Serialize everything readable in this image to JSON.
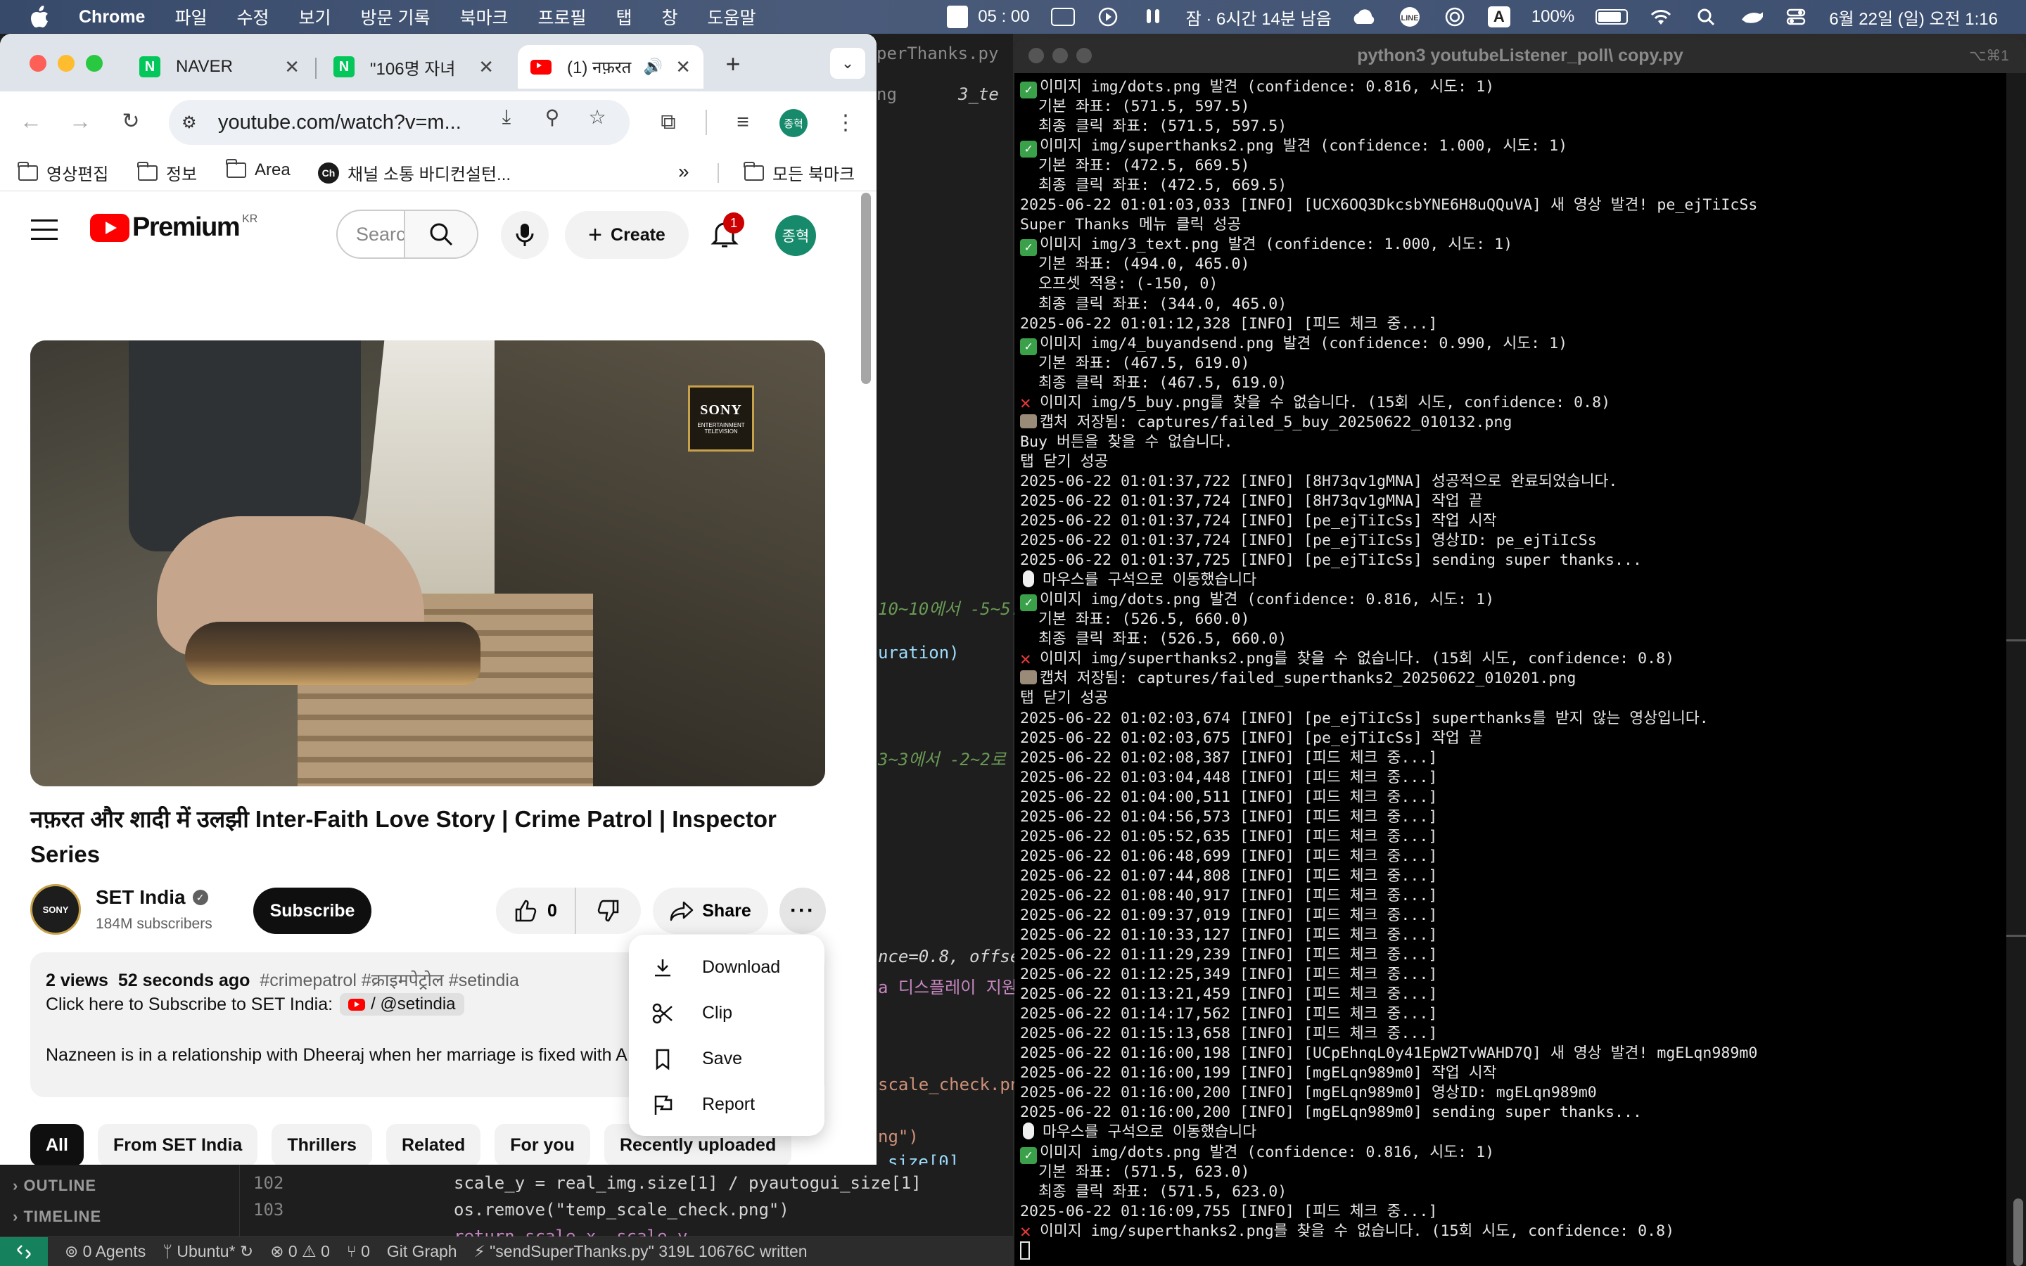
{
  "menubar": {
    "app": "Chrome",
    "menus": [
      "파일",
      "수정",
      "보기",
      "방문 기록",
      "북마크",
      "프로필",
      "탭",
      "창",
      "도움말"
    ],
    "timer": "05 : 00",
    "sleep_status": "잠 · 6시간 14분 남음",
    "input_source": "A",
    "battery": "100%",
    "datetime": "6월 22일 (일) 오전 1:16"
  },
  "chrome": {
    "tabs": [
      {
        "title": "NAVER",
        "favicon": "N",
        "color": "#03c75a"
      },
      {
        "title": "\"106명 자녀",
        "favicon": "N",
        "color": "#03c75a"
      },
      {
        "title": "(1) नफ़रत",
        "favicon": "yt",
        "color": "#ff0000"
      }
    ],
    "url": "youtube.com/watch?v=m...",
    "profile_initial": "종혁",
    "bookmarks": [
      "영상편집",
      "정보",
      "Area",
      "채널 소통 바디컨설턴...",
      "모든 북마크"
    ],
    "bookmark_ch_icon": "Ch"
  },
  "youtube": {
    "logo": "Premium",
    "region": "KR",
    "search_placeholder": "Search",
    "create_label": "Create",
    "notif_count": "1",
    "avatar": "종혁",
    "video_title": "नफ़रत और शादी में उलझी Inter-Faith Love Story | Crime Patrol | Inspector Series",
    "sony_badge_top": "SONY",
    "sony_badge_bottom": "ENTERTAINMENT TELEVISION",
    "channel": {
      "name": "SET India",
      "subscribers": "184M subscribers",
      "avatar_text": "SONY"
    },
    "subscribe_label": "Subscribe",
    "likes": "0",
    "share_label": "Share",
    "description": {
      "views": "2 views",
      "age": "52 seconds ago",
      "tags": "#crimepatrol #क्राइमपेट्रोल #setindia",
      "subscribe_line": "Click here to Subscribe to SET India:",
      "handle": "/ @setindia",
      "body": "Nazneen is in a relationship with Dheeraj when her marriage is fixed with A"
    },
    "menu": [
      {
        "label": "Download",
        "icon": "download-icon"
      },
      {
        "label": "Clip",
        "icon": "scissors-icon"
      },
      {
        "label": "Save",
        "icon": "bookmark-icon"
      },
      {
        "label": "Report",
        "icon": "flag-icon"
      }
    ],
    "chips": [
      "All",
      "From SET India",
      "Thrillers",
      "Related",
      "For you",
      "Recently uploaded"
    ]
  },
  "editor": {
    "tab_fragment": "3_te",
    "tab_fragment2": "ng",
    "upper_tab_text": "perThanks.py",
    "fragments": {
      "range1": "10~10에서 -5~5.",
      "duration": "uration)",
      "range2": "3~3에서 -2~2로",
      "conf": "nce=0.8, offse",
      "display": "a 디스플레이 지원",
      "scale_png": "scale_check.pn",
      "ng": "ng\")",
      "size0": "size[0]"
    },
    "sidebar_sections": [
      "OUTLINE",
      "TIMELINE"
    ],
    "lines": [
      {
        "no": "102",
        "code": "scale_y = real_img.size[1] / pyautogui_size[1]"
      },
      {
        "no": "103",
        "code": "os.remove(\"temp_scale_check.png\")"
      }
    ],
    "partial_line": "return scale_x, scale_y"
  },
  "statusbar": {
    "agents": "0 Agents",
    "remote": "Ubuntu*",
    "problems": "0 ⚠ 0",
    "ports": "0",
    "git": "Git Graph",
    "message": "\"sendSuperThanks.py\" 319L 10676C written"
  },
  "terminal": {
    "title": "python3 youtubeListener_poll\\ copy.py",
    "shortcut": "⌥⌘1",
    "lines": [
      {
        "icon": "ok",
        "text": "이미지 img/dots.png 발견 (confidence: 0.816, 시도: 1)"
      },
      {
        "icon": "",
        "text": "  기본 좌표: (571.5, 597.5)"
      },
      {
        "icon": "",
        "text": "  최종 클릭 좌표: (571.5, 597.5)"
      },
      {
        "icon": "ok",
        "text": "이미지 img/superthanks2.png 발견 (confidence: 1.000, 시도: 1)"
      },
      {
        "icon": "",
        "text": "  기본 좌표: (472.5, 669.5)"
      },
      {
        "icon": "",
        "text": "  최종 클릭 좌표: (472.5, 669.5)"
      },
      {
        "icon": "",
        "text": "2025-06-22 01:01:03,033 [INFO] [UCX6OQ3DkcsbYNE6H8uQQuVA] 새 영상 발견! pe_ejTiIcSs"
      },
      {
        "icon": "",
        "text": "Super Thanks 메뉴 클릭 성공"
      },
      {
        "icon": "ok",
        "text": "이미지 img/3_text.png 발견 (confidence: 1.000, 시도: 1)"
      },
      {
        "icon": "",
        "text": "  기본 좌표: (494.0, 465.0)"
      },
      {
        "icon": "",
        "text": "  오프셋 적용: (-150, 0)"
      },
      {
        "icon": "",
        "text": "  최종 클릭 좌표: (344.0, 465.0)"
      },
      {
        "icon": "",
        "text": "2025-06-22 01:01:12,328 [INFO] [피드 체크 중...]"
      },
      {
        "icon": "ok",
        "text": "이미지 img/4_buyandsend.png 발견 (confidence: 0.990, 시도: 1)"
      },
      {
        "icon": "",
        "text": "  기본 좌표: (467.5, 619.0)"
      },
      {
        "icon": "",
        "text": "  최종 클릭 좌표: (467.5, 619.0)"
      },
      {
        "icon": "x",
        "text": "이미지 img/5_buy.png를 찾을 수 없습니다. (15회 시도, confidence: 0.8)"
      },
      {
        "icon": "cam",
        "text": "캡처 저장됨: captures/failed_5_buy_20250622_010132.png"
      },
      {
        "icon": "",
        "text": "Buy 버튼을 찾을 수 없습니다."
      },
      {
        "icon": "",
        "text": "탭 닫기 성공"
      },
      {
        "icon": "",
        "text": "2025-06-22 01:01:37,722 [INFO] [8H73qv1gMNA] 성공적으로 완료되었습니다."
      },
      {
        "icon": "",
        "text": "2025-06-22 01:01:37,724 [INFO] [8H73qv1gMNA] 작업 끝"
      },
      {
        "icon": "",
        "text": "2025-06-22 01:01:37,724 [INFO] [pe_ejTiIcSs] 작업 시작"
      },
      {
        "icon": "",
        "text": "2025-06-22 01:01:37,724 [INFO] [pe_ejTiIcSs] 영상ID: pe_ejTiIcSs"
      },
      {
        "icon": "",
        "text": "2025-06-22 01:01:37,725 [INFO] [pe_ejTiIcSs] sending super thanks..."
      },
      {
        "icon": "mouse",
        "text": "마우스를 구석으로 이동했습니다"
      },
      {
        "icon": "ok",
        "text": "이미지 img/dots.png 발견 (confidence: 0.816, 시도: 1)"
      },
      {
        "icon": "",
        "text": "  기본 좌표: (526.5, 660.0)"
      },
      {
        "icon": "",
        "text": "  최종 클릭 좌표: (526.5, 660.0)"
      },
      {
        "icon": "x",
        "text": "이미지 img/superthanks2.png를 찾을 수 없습니다. (15회 시도, confidence: 0.8)"
      },
      {
        "icon": "cam",
        "text": "캡처 저장됨: captures/failed_superthanks2_20250622_010201.png"
      },
      {
        "icon": "",
        "text": "탭 닫기 성공"
      },
      {
        "icon": "",
        "text": "2025-06-22 01:02:03,674 [INFO] [pe_ejTiIcSs] superthanks를 받지 않는 영상입니다."
      },
      {
        "icon": "",
        "text": "2025-06-22 01:02:03,675 [INFO] [pe_ejTiIcSs] 작업 끝"
      },
      {
        "icon": "",
        "text": "2025-06-22 01:02:08,387 [INFO] [피드 체크 중...]"
      },
      {
        "icon": "",
        "text": "2025-06-22 01:03:04,448 [INFO] [피드 체크 중...]"
      },
      {
        "icon": "",
        "text": "2025-06-22 01:04:00,511 [INFO] [피드 체크 중...]"
      },
      {
        "icon": "",
        "text": "2025-06-22 01:04:56,573 [INFO] [피드 체크 중...]"
      },
      {
        "icon": "",
        "text": "2025-06-22 01:05:52,635 [INFO] [피드 체크 중...]"
      },
      {
        "icon": "",
        "text": "2025-06-22 01:06:48,699 [INFO] [피드 체크 중...]"
      },
      {
        "icon": "",
        "text": "2025-06-22 01:07:44,808 [INFO] [피드 체크 중...]"
      },
      {
        "icon": "",
        "text": "2025-06-22 01:08:40,917 [INFO] [피드 체크 중...]"
      },
      {
        "icon": "",
        "text": "2025-06-22 01:09:37,019 [INFO] [피드 체크 중...]"
      },
      {
        "icon": "",
        "text": "2025-06-22 01:10:33,127 [INFO] [피드 체크 중...]"
      },
      {
        "icon": "",
        "text": "2025-06-22 01:11:29,239 [INFO] [피드 체크 중...]"
      },
      {
        "icon": "",
        "text": "2025-06-22 01:12:25,349 [INFO] [피드 체크 중...]"
      },
      {
        "icon": "",
        "text": "2025-06-22 01:13:21,459 [INFO] [피드 체크 중...]"
      },
      {
        "icon": "",
        "text": "2025-06-22 01:14:17,562 [INFO] [피드 체크 중...]"
      },
      {
        "icon": "",
        "text": "2025-06-22 01:15:13,658 [INFO] [피드 체크 중...]"
      },
      {
        "icon": "",
        "text": "2025-06-22 01:16:00,198 [INFO] [UCpEhnqL0y41EpW2TvWAHD7Q] 새 영상 발견! mgELqn989m0"
      },
      {
        "icon": "",
        "text": "2025-06-22 01:16:00,199 [INFO] [mgELqn989m0] 작업 시작"
      },
      {
        "icon": "",
        "text": "2025-06-22 01:16:00,200 [INFO] [mgELqn989m0] 영상ID: mgELqn989m0"
      },
      {
        "icon": "",
        "text": "2025-06-22 01:16:00,200 [INFO] [mgELqn989m0] sending super thanks..."
      },
      {
        "icon": "mouse",
        "text": "마우스를 구석으로 이동했습니다"
      },
      {
        "icon": "ok",
        "text": "이미지 img/dots.png 발견 (confidence: 0.816, 시도: 1)"
      },
      {
        "icon": "",
        "text": "  기본 좌표: (571.5, 623.0)"
      },
      {
        "icon": "",
        "text": "  최종 클릭 좌표: (571.5, 623.0)"
      },
      {
        "icon": "",
        "text": "2025-06-22 01:16:09,755 [INFO] [피드 체크 중...]"
      },
      {
        "icon": "x",
        "text": "이미지 img/superthanks2.png를 찾을 수 없습니다. (15회 시도, confidence: 0.8)"
      },
      {
        "icon": "cursor",
        "text": ""
      }
    ]
  }
}
